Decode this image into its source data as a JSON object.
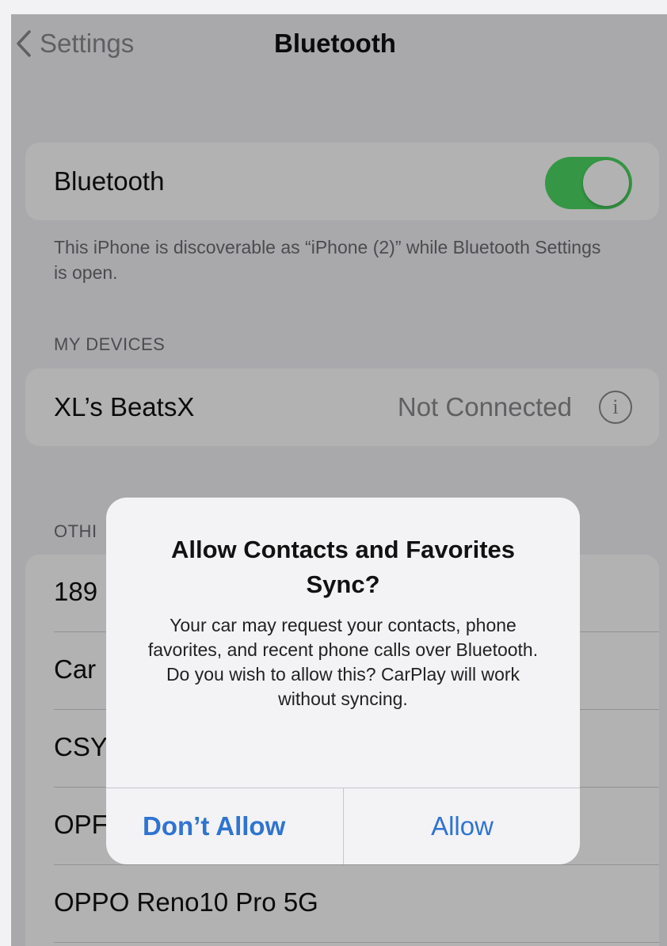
{
  "nav": {
    "back_label": "Settings",
    "title": "Bluetooth"
  },
  "bluetooth": {
    "label": "Bluetooth",
    "enabled": true,
    "toggle_color": "#4cd964",
    "footnote": "This iPhone is discoverable as “iPhone (2)” while Bluetooth Settings is open."
  },
  "my_devices": {
    "header": "MY DEVICES",
    "items": [
      {
        "name": "XL’s BeatsX",
        "status": "Not Connected",
        "icon": "info-icon"
      }
    ]
  },
  "other_devices": {
    "header": "OTHI",
    "items": [
      {
        "name": "189"
      },
      {
        "name": "Car"
      },
      {
        "name": "CSY"
      },
      {
        "name": "OPF"
      },
      {
        "name": "OPPO Reno10 Pro 5G"
      }
    ]
  },
  "alert": {
    "title": "Allow Contacts and Favorites Sync?",
    "message": "Your car may request your contacts, phone favorites, and recent phone calls over Bluetooth. Do you wish to allow this? CarPlay will work without syncing.",
    "buttons": {
      "deny": "Don’t Allow",
      "allow": "Allow"
    },
    "accent_color": "#2f74d0"
  }
}
